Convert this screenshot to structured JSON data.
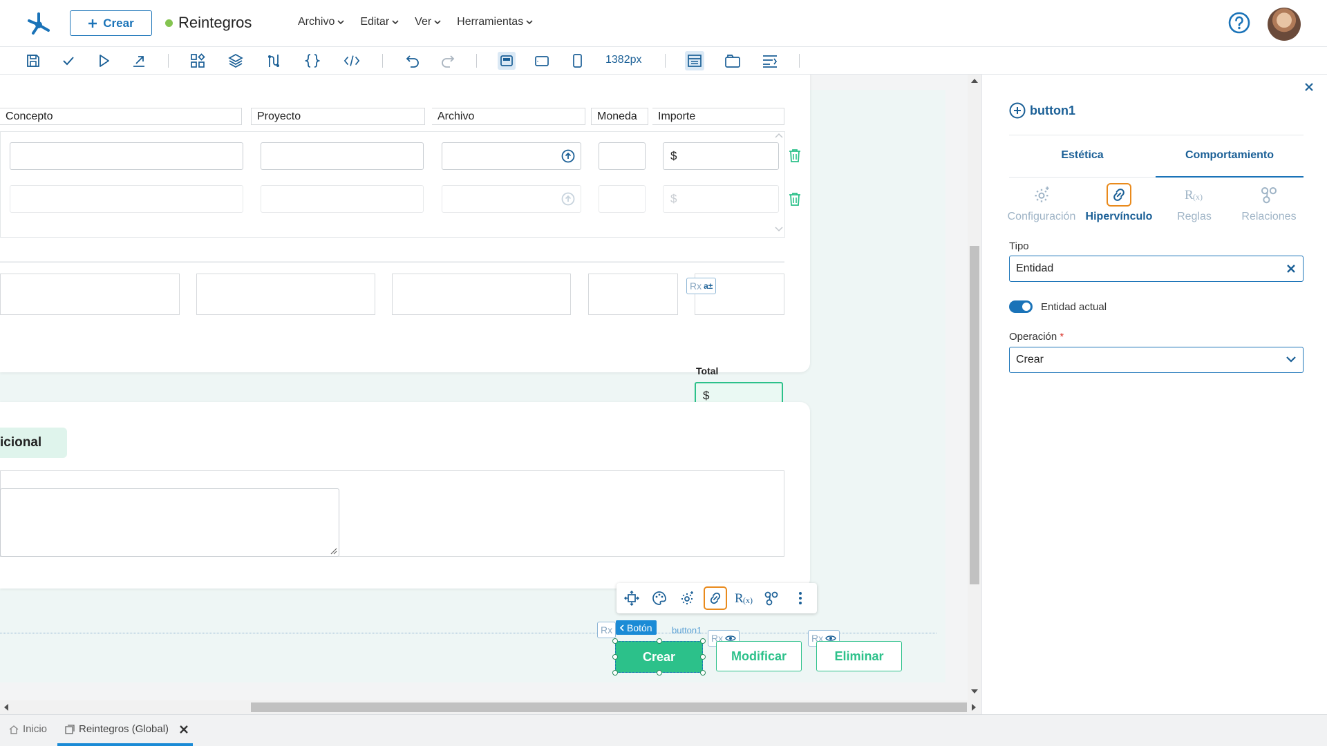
{
  "header": {
    "create_label": "Crear",
    "app_name": "Reintegros",
    "menu": [
      "Archivo",
      "Editar",
      "Ver",
      "Herramientas"
    ]
  },
  "toolbar": {
    "width_label": "1382px"
  },
  "form": {
    "columns": [
      "Concepto",
      "Proyecto",
      "Archivo",
      "Moneda",
      "Importe"
    ],
    "currency_symbol": "$",
    "total_label": "Total",
    "total_value": "$",
    "rx": "Rx",
    "rx_icon_label": "a±",
    "section_label": "icional"
  },
  "actions": {
    "boton_tag": "Botón",
    "button_name_tag": "button1",
    "create": "Crear",
    "modify": "Modificar",
    "delete": "Eliminar"
  },
  "panel": {
    "title": "button1",
    "tabs": [
      "Estética",
      "Comportamiento"
    ],
    "subtabs": [
      "Configuración",
      "Hipervínculo",
      "Reglas",
      "Relaciones"
    ],
    "tipo_label": "Tipo",
    "tipo_value": "Entidad",
    "toggle_label": "Entidad actual",
    "operacion_label": "Operación",
    "required_mark": "*",
    "operacion_value": "Crear"
  },
  "bottom_tabs": {
    "home": "Inicio",
    "current": "Reintegros (Global)"
  },
  "colors": {
    "primary": "#1a73b8",
    "accent_green": "#2cc18a",
    "highlight_orange": "#e98a1c",
    "status_dot": "#84c450"
  }
}
